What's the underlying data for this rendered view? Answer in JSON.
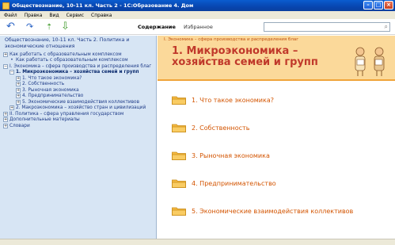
{
  "window": {
    "title": "Обществознание, 10-11 кл. Часть 2 - 1С:Образование 4. Дом"
  },
  "menu": [
    "Файл",
    "Правка",
    "Вид",
    "Сервис",
    "Справка"
  ],
  "toolbar": {
    "tabs": {
      "contents": "Содержание",
      "favorites": "Избранное"
    },
    "search": {
      "placeholder": ""
    }
  },
  "sidebar": {
    "header": "Обществознание, 10-11 кл. Часть 2. Политика и экономические отношения",
    "tree": [
      {
        "label": "Как работать с образовательным комплексом",
        "level": 0,
        "marker": "+"
      },
      {
        "label": "Как работать с образовательным комплексом",
        "level": 1,
        "marker": "•"
      },
      {
        "label": "I. Экономика – сфера производства и распределения благ",
        "level": 0,
        "marker": "−"
      },
      {
        "label": "1. Микроэкономика – хозяйства семей и групп",
        "level": 1,
        "marker": "−",
        "selected": true
      },
      {
        "label": "1. Что такое экономика?",
        "level": 2,
        "marker": "+"
      },
      {
        "label": "2. Собственность",
        "level": 2,
        "marker": "+"
      },
      {
        "label": "3. Рыночная экономика",
        "level": 2,
        "marker": "+"
      },
      {
        "label": "4. Предпринимательство",
        "level": 2,
        "marker": "+"
      },
      {
        "label": "5. Экономические взаимодействия коллективов",
        "level": 2,
        "marker": "+"
      },
      {
        "label": "2. Макроэкономика – хозяйство стран и цивилизаций",
        "level": 1,
        "marker": "+"
      },
      {
        "label": "II. Политика – сфера управления государством",
        "level": 0,
        "marker": "+"
      },
      {
        "label": "Дополнительные материалы",
        "level": 0,
        "marker": "+"
      },
      {
        "label": "Словари",
        "level": 0,
        "marker": "+"
      }
    ]
  },
  "content": {
    "breadcrumb": "I. Экономика – сфера производства и распределения благ",
    "heading": "1. Микроэкономика – хозяйства семей и групп",
    "items": [
      "1. Что такое экономика?",
      "2. Собственность",
      "3. Рыночная экономика",
      "4. Предпринимательство",
      "5. Экономические взаимодействия коллективов"
    ]
  },
  "colors": {
    "accent": "#d35400",
    "sidebar_bg": "#d7e5f4",
    "banner_bg": "#fbd99a"
  }
}
